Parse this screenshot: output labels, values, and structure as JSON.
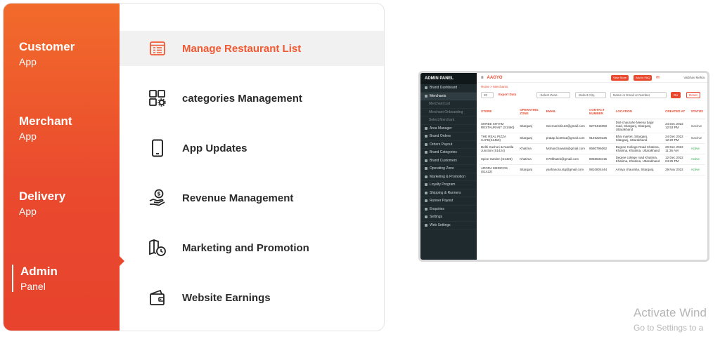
{
  "sidebar": {
    "items": [
      {
        "title": "Customer",
        "sub": "App"
      },
      {
        "title": "Merchant",
        "sub": "App"
      },
      {
        "title": "Delivery",
        "sub": "App"
      },
      {
        "title": "Admin",
        "sub": "Panel"
      }
    ],
    "active_index": 3
  },
  "menu": {
    "items": [
      {
        "label": "Manage Restaurant List",
        "icon": "list-icon"
      },
      {
        "label": "categories Management",
        "icon": "categories-icon"
      },
      {
        "label": "App Updates",
        "icon": "phone-icon"
      },
      {
        "label": "Revenue Management",
        "icon": "revenue-icon"
      },
      {
        "label": "Marketing and Promotion",
        "icon": "map-clock-icon"
      },
      {
        "label": "Website Earnings",
        "icon": "wallet-icon"
      }
    ],
    "active_index": 0
  },
  "admin": {
    "panel_title": "ADMIN PANEL",
    "brand": "AAGYO",
    "view_store": "View Store",
    "add_faq": "Add in FAQ",
    "user": "Vaibhav Mehta",
    "breadcrumb": "Home > Merchants",
    "side_items": [
      {
        "label": "Brand Dashboard",
        "type": "item"
      },
      {
        "label": "Merchants",
        "type": "active"
      },
      {
        "label": "Merchant List",
        "type": "sub"
      },
      {
        "label": "Merchant Onboarding",
        "type": "sub"
      },
      {
        "label": "Select Merchant",
        "type": "sub"
      },
      {
        "label": "Area Manager",
        "type": "item"
      },
      {
        "label": "Brand Orders",
        "type": "item"
      },
      {
        "label": "Orders Payout",
        "type": "item"
      },
      {
        "label": "Brand Categories",
        "type": "item"
      },
      {
        "label": "Brand Customers",
        "type": "item"
      },
      {
        "label": "Operating Zone",
        "type": "item"
      },
      {
        "label": "Marketing & Promotion",
        "type": "item"
      },
      {
        "label": "Loyalty Program",
        "type": "item"
      },
      {
        "label": "Shipping & Runners",
        "type": "item"
      },
      {
        "label": "Runner Payout",
        "type": "item"
      },
      {
        "label": "Enquiries",
        "type": "item"
      },
      {
        "label": "Settings",
        "type": "item"
      },
      {
        "label": "Web Settings",
        "type": "item"
      }
    ],
    "filters": {
      "per_page": "20",
      "export": "Export Data",
      "zone": "-Select Zone-",
      "city": "-Select City-",
      "search_placeholder": "Name or Email or Number",
      "go": "Go",
      "reset": "Reset"
    },
    "table": {
      "headers": [
        "STORE",
        "OPERATING ZONE",
        "EMAIL",
        "CONTACT NUMBER",
        "LOCATION",
        "CREATED AT",
        "STATUS"
      ],
      "rows": [
        [
          "SHREE SHYAM RESTAURANT (S1460)",
          "Sitarganj",
          "Seemarishi123@gmail.com",
          "9279446050",
          "Dist-chaurahe Meena bajar road, Sitarganj, Sitarganj, Uttarakhand",
          "24 Dec 2022 12:53 PM",
          "Inactive"
        ],
        [
          "THE REAL PIZZA CAFE(S1450)",
          "Sitarganj",
          "pratap.loo0011@gmail.com",
          "9149228136",
          "Bhai market, Sitarganj, Sitarganj, Uttarakhand",
          "24 Dec 2022 12:20 PM",
          "Inactive"
        ],
        [
          "Delhi Kachori & Nutella Junction (S1424)",
          "Khatima",
          "Mohanchawala@gmail.com",
          "9580796062",
          "Degree College Road Khatima, Khatima, Khatima, Uttarakhand",
          "20 Dec 2022 11:36 AM",
          "Active"
        ],
        [
          "Spice Garden (S1423)",
          "Khatima",
          "K79khatek@gmail.com",
          "8058633415",
          "Degree college road Khatima, Khatima, Khatima, Uttarakhand",
          "12 Dec 2022 04:25 PM",
          "Active"
        ],
        [
          "ARORA MEDICOS (S1422)",
          "Sitarganj",
          "yashanora.stg@gmail.com",
          "9810804444",
          "Arrirya chauraha, Sitarganj,",
          "29 Nov 2022",
          "Active"
        ]
      ]
    }
  },
  "watermark": {
    "line1": "Activate Wind",
    "line2": "Go to Settings to a"
  },
  "colors": {
    "accent": "#ef5a33",
    "sidebar_gradient_top": "#f26b2b",
    "sidebar_gradient_bottom": "#e7432d",
    "admin_sidebar": "#1f2a2e",
    "status_active": "#2aa84a"
  }
}
